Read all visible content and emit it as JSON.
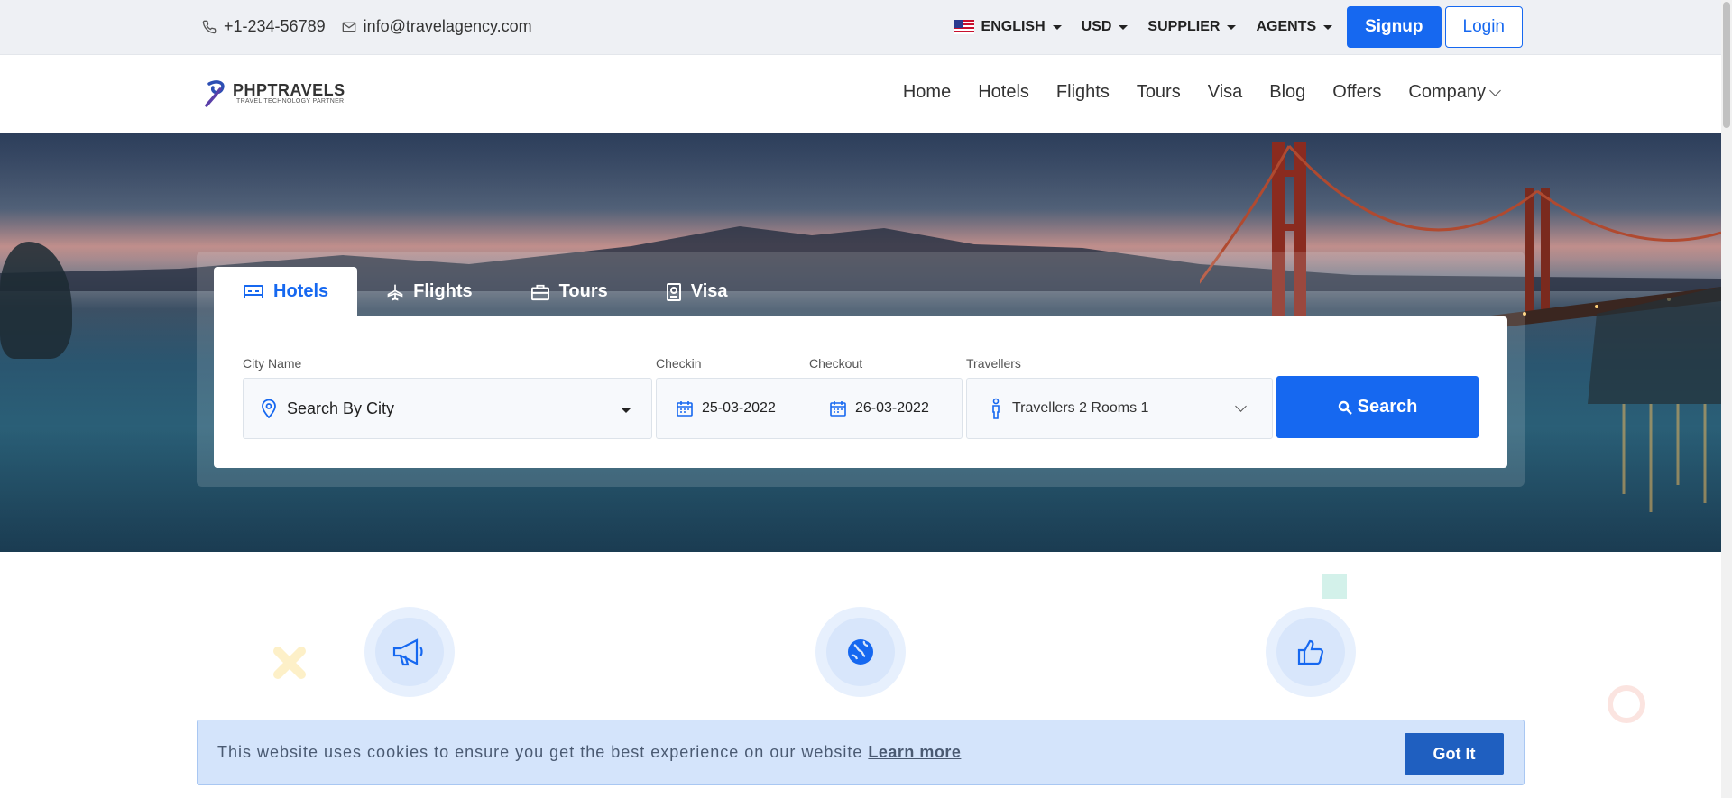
{
  "topbar": {
    "phone": "+1-234-56789",
    "email": "info@travelagency.com",
    "language": "ENGLISH",
    "currency": "USD",
    "supplier": "SUPPLIER",
    "agents": "AGENTS",
    "signup": "Signup",
    "login": "Login"
  },
  "logo": {
    "name": "PHPTRAVELS",
    "tagline": "TRAVEL TECHNOLOGY PARTNER"
  },
  "nav": [
    "Home",
    "Hotels",
    "Flights",
    "Tours",
    "Visa",
    "Blog",
    "Offers",
    "Company"
  ],
  "search": {
    "tabs": [
      "Hotels",
      "Flights",
      "Tours",
      "Visa"
    ],
    "active_tab": "Hotels",
    "city_label": "City Name",
    "city_placeholder": "Search By City",
    "checkin_label": "Checkin",
    "checkin_value": "25-03-2022",
    "checkout_label": "Checkout",
    "checkout_value": "26-03-2022",
    "travellers_label": "Travellers",
    "travellers_value": "Travellers 2 Rooms 1",
    "search_button": "Search"
  },
  "cookie": {
    "message": "This website uses cookies to ensure you get the best experience on our website",
    "learn_more": "Learn more",
    "got_it": "Got It"
  },
  "colors": {
    "primary": "#1668f0",
    "cookie_bg": "#d4e4fb",
    "cookie_button": "#1f5fc0"
  }
}
